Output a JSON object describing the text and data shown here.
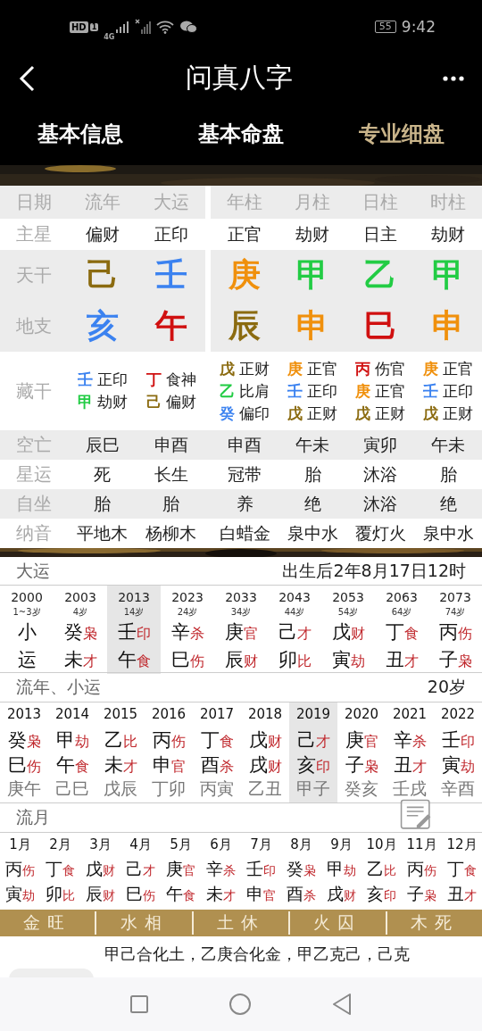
{
  "status_bar": {
    "badges": [
      "HD",
      "1"
    ],
    "network": "4G",
    "battery": "55",
    "time": "9:42"
  },
  "title_bar": {
    "title": "问真八字"
  },
  "tabs": [
    {
      "label": "基本信息",
      "selected": false
    },
    {
      "label": "基本命盘",
      "selected": false
    },
    {
      "label": "专业细盘",
      "selected": true
    }
  ],
  "chart": {
    "row_labels": [
      "日期",
      "主星",
      "天干",
      "地支",
      "藏干",
      "空亡",
      "星运",
      "自坐",
      "纳音"
    ],
    "columns": [
      {
        "header": "流年",
        "main_star": "偏财",
        "stem": {
          "char": "己",
          "color": "#8b6b10"
        },
        "branch": {
          "char": "亥",
          "color": "#3b82f0"
        },
        "hidden": [
          {
            "char": "壬",
            "color": "#3b82f0",
            "god": "正印"
          },
          {
            "char": "甲",
            "color": "#22cc44",
            "god": "劫财"
          }
        ],
        "void": "辰巳",
        "star_fortune": "死",
        "self_seat": "胎",
        "nayin": "平地木"
      },
      {
        "header": "大运",
        "main_star": "正印",
        "stem": {
          "char": "壬",
          "color": "#3b82f0"
        },
        "branch": {
          "char": "午",
          "color": "#d01010"
        },
        "hidden": [
          {
            "char": "丁",
            "color": "#d01010",
            "god": "食神"
          },
          {
            "char": "己",
            "color": "#8b6b10",
            "god": "偏财"
          }
        ],
        "void": "申酉",
        "star_fortune": "长生",
        "self_seat": "胎",
        "nayin": "杨柳木"
      },
      {
        "header": "年柱",
        "main_star": "正官",
        "stem": {
          "char": "庚",
          "color": "#f0900c"
        },
        "branch": {
          "char": "辰",
          "color": "#8b6b10"
        },
        "hidden": [
          {
            "char": "戊",
            "color": "#8b6b10",
            "god": "正财"
          },
          {
            "char": "乙",
            "color": "#22cc44",
            "god": "比肩"
          },
          {
            "char": "癸",
            "color": "#3b82f0",
            "god": "偏印"
          }
        ],
        "void": "申酉",
        "star_fortune": "冠带",
        "self_seat": "养",
        "nayin": "白蜡金"
      },
      {
        "header": "月柱",
        "main_star": "劫财",
        "stem": {
          "char": "甲",
          "color": "#22cc44"
        },
        "branch": {
          "char": "申",
          "color": "#f0900c"
        },
        "hidden": [
          {
            "char": "庚",
            "color": "#f0900c",
            "god": "正官"
          },
          {
            "char": "壬",
            "color": "#3b82f0",
            "god": "正印"
          },
          {
            "char": "戊",
            "color": "#8b6b10",
            "god": "正财"
          }
        ],
        "void": "午未",
        "star_fortune": "胎",
        "self_seat": "绝",
        "nayin": "泉中水"
      },
      {
        "header": "日柱",
        "main_star": "日主",
        "stem": {
          "char": "乙",
          "color": "#22cc44"
        },
        "branch": {
          "char": "巳",
          "color": "#d01010"
        },
        "hidden": [
          {
            "char": "丙",
            "color": "#d01010",
            "god": "伤官"
          },
          {
            "char": "庚",
            "color": "#f0900c",
            "god": "正官"
          },
          {
            "char": "戊",
            "color": "#8b6b10",
            "god": "正财"
          }
        ],
        "void": "寅卯",
        "star_fortune": "沐浴",
        "self_seat": "沐浴",
        "nayin": "覆灯火"
      },
      {
        "header": "时柱",
        "main_star": "劫财",
        "stem": {
          "char": "甲",
          "color": "#22cc44"
        },
        "branch": {
          "char": "申",
          "color": "#f0900c"
        },
        "hidden": [
          {
            "char": "庚",
            "color": "#f0900c",
            "god": "正官"
          },
          {
            "char": "壬",
            "color": "#3b82f0",
            "god": "正印"
          },
          {
            "char": "戊",
            "color": "#8b6b10",
            "god": "正财"
          }
        ],
        "void": "午未",
        "star_fortune": "胎",
        "self_seat": "绝",
        "nayin": "泉中水"
      }
    ]
  },
  "dayun": {
    "title": "大运",
    "start": "出生后2年8月17日12时",
    "items": [
      {
        "year": "2000",
        "age": "1~3岁",
        "stem": "小",
        "branch": "运",
        "selected": false
      },
      {
        "year": "2003",
        "age": "4岁",
        "stem": "癸",
        "stem_god": "枭",
        "branch": "未",
        "branch_god": "才",
        "selected": false
      },
      {
        "year": "2013",
        "age": "14岁",
        "stem": "壬",
        "stem_god": "印",
        "branch": "午",
        "branch_god": "食",
        "selected": true
      },
      {
        "year": "2023",
        "age": "24岁",
        "stem": "辛",
        "stem_god": "杀",
        "branch": "巳",
        "branch_god": "伤",
        "selected": false
      },
      {
        "year": "2033",
        "age": "34岁",
        "stem": "庚",
        "stem_god": "官",
        "branch": "辰",
        "branch_god": "财",
        "selected": false
      },
      {
        "year": "2043",
        "age": "44岁",
        "stem": "己",
        "stem_god": "才",
        "branch": "卯",
        "branch_god": "比",
        "selected": false
      },
      {
        "year": "2053",
        "age": "54岁",
        "stem": "戊",
        "stem_god": "财",
        "branch": "寅",
        "branch_god": "劫",
        "selected": false
      },
      {
        "year": "2063",
        "age": "64岁",
        "stem": "丁",
        "stem_god": "食",
        "branch": "丑",
        "branch_god": "才",
        "selected": false
      },
      {
        "year": "2073",
        "age": "74岁",
        "stem": "丙",
        "stem_god": "伤",
        "branch": "子",
        "branch_god": "枭",
        "selected": false
      }
    ]
  },
  "liunian": {
    "title": "流年、小运",
    "age": "20岁",
    "items": [
      {
        "year": "2013",
        "stem": "癸",
        "stem_god": "枭",
        "branch": "巳",
        "branch_god": "伤",
        "xiaoyun": "庚午",
        "selected": false
      },
      {
        "year": "2014",
        "stem": "甲",
        "stem_god": "劫",
        "branch": "午",
        "branch_god": "食",
        "xiaoyun": "己巳",
        "selected": false
      },
      {
        "year": "2015",
        "stem": "乙",
        "stem_god": "比",
        "branch": "未",
        "branch_god": "才",
        "xiaoyun": "戊辰",
        "selected": false
      },
      {
        "year": "2016",
        "stem": "丙",
        "stem_god": "伤",
        "branch": "申",
        "branch_god": "官",
        "xiaoyun": "丁卯",
        "selected": false
      },
      {
        "year": "2017",
        "stem": "丁",
        "stem_god": "食",
        "branch": "酉",
        "branch_god": "杀",
        "xiaoyun": "丙寅",
        "selected": false
      },
      {
        "year": "2018",
        "stem": "戊",
        "stem_god": "财",
        "branch": "戌",
        "branch_god": "财",
        "xiaoyun": "乙丑",
        "selected": false
      },
      {
        "year": "2019",
        "stem": "己",
        "stem_god": "才",
        "branch": "亥",
        "branch_god": "印",
        "xiaoyun": "甲子",
        "selected": true
      },
      {
        "year": "2020",
        "stem": "庚",
        "stem_god": "官",
        "branch": "子",
        "branch_god": "枭",
        "xiaoyun": "癸亥",
        "selected": false
      },
      {
        "year": "2021",
        "stem": "辛",
        "stem_god": "杀",
        "branch": "丑",
        "branch_god": "才",
        "xiaoyun": "壬戌",
        "selected": false
      },
      {
        "year": "2022",
        "stem": "壬",
        "stem_god": "印",
        "branch": "寅",
        "branch_god": "劫",
        "xiaoyun": "辛酉",
        "selected": false
      }
    ]
  },
  "liuyue": {
    "title": "流月",
    "items": [
      {
        "month": "1月",
        "stem": "丙",
        "stem_god": "伤",
        "branch": "寅",
        "branch_god": "劫"
      },
      {
        "month": "2月",
        "stem": "丁",
        "stem_god": "食",
        "branch": "卯",
        "branch_god": "比"
      },
      {
        "month": "3月",
        "stem": "戊",
        "stem_god": "财",
        "branch": "辰",
        "branch_god": "财"
      },
      {
        "month": "4月",
        "stem": "己",
        "stem_god": "才",
        "branch": "巳",
        "branch_god": "伤"
      },
      {
        "month": "5月",
        "stem": "庚",
        "stem_god": "官",
        "branch": "午",
        "branch_god": "食"
      },
      {
        "month": "6月",
        "stem": "辛",
        "stem_god": "杀",
        "branch": "未",
        "branch_god": "才"
      },
      {
        "month": "7月",
        "stem": "壬",
        "stem_god": "印",
        "branch": "申",
        "branch_god": "官"
      },
      {
        "month": "8月",
        "stem": "癸",
        "stem_god": "枭",
        "branch": "酉",
        "branch_god": "杀"
      },
      {
        "month": "9月",
        "stem": "甲",
        "stem_god": "劫",
        "branch": "戌",
        "branch_god": "财"
      },
      {
        "month": "10月",
        "stem": "乙",
        "stem_god": "比",
        "branch": "亥",
        "branch_god": "印"
      },
      {
        "month": "11月",
        "stem": "丙",
        "stem_god": "伤",
        "branch": "子",
        "branch_god": "枭"
      },
      {
        "month": "12月",
        "stem": "丁",
        "stem_god": "食",
        "branch": "丑",
        "branch_god": "才"
      }
    ]
  },
  "strength_bar": [
    "金旺",
    "水相",
    "土休",
    "火囚",
    "木死"
  ],
  "analysis": "甲己合化土，乙庚合化金，甲乙克己，己克"
}
